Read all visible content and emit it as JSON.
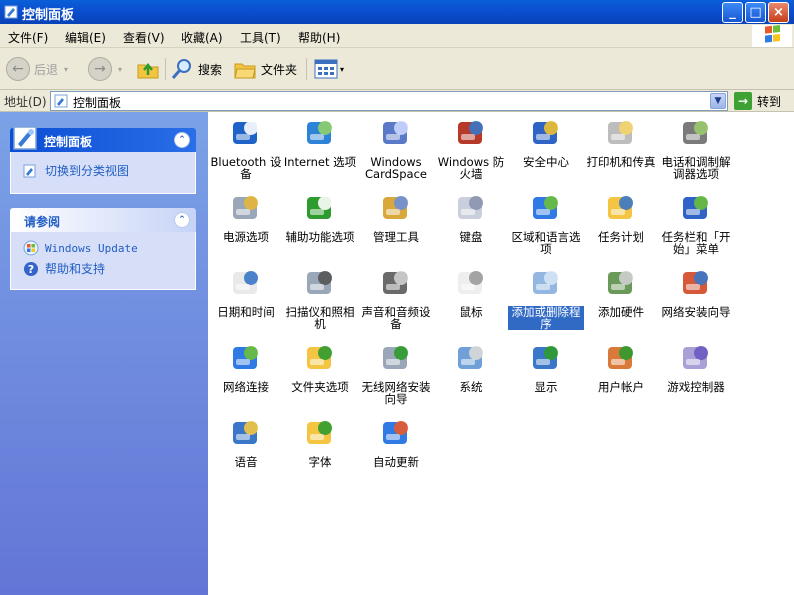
{
  "window": {
    "title": "控制面板",
    "controls": {
      "minimize": "_",
      "maximize": "□",
      "close": "×"
    }
  },
  "menubar": [
    "文件(F)",
    "编辑(E)",
    "查看(V)",
    "收藏(A)",
    "工具(T)",
    "帮助(H)"
  ],
  "toolbar": {
    "back": "后退",
    "search": "搜索",
    "folders": "文件夹"
  },
  "address": {
    "label": "地址(D)",
    "value": "控制面板",
    "go": "转到"
  },
  "sidebar": {
    "control_panel": {
      "title": "控制面板",
      "link": "切换到分类视图"
    },
    "see_also": {
      "title": "请参阅",
      "links": [
        "Windows Update",
        "帮助和支持"
      ]
    }
  },
  "items": [
    {
      "label": "Bluetooth 设备",
      "icon": "bluetooth-icon"
    },
    {
      "label": "Internet 选项",
      "icon": "internet-options-icon"
    },
    {
      "label": "Windows CardSpace",
      "icon": "cardspace-icon"
    },
    {
      "label": "Windows 防火墙",
      "icon": "firewall-icon"
    },
    {
      "label": "安全中心",
      "icon": "security-center-icon"
    },
    {
      "label": "打印机和传真",
      "icon": "printer-icon"
    },
    {
      "label": "电话和调制解调器选项",
      "icon": "phone-modem-icon"
    },
    {
      "label": "电源选项",
      "icon": "power-options-icon"
    },
    {
      "label": "辅助功能选项",
      "icon": "accessibility-icon"
    },
    {
      "label": "管理工具",
      "icon": "admin-tools-icon"
    },
    {
      "label": "键盘",
      "icon": "keyboard-icon"
    },
    {
      "label": "区域和语言选项",
      "icon": "globe-icon"
    },
    {
      "label": "任务计划",
      "icon": "scheduled-tasks-icon"
    },
    {
      "label": "任务栏和「开始」菜单",
      "icon": "taskbar-icon"
    },
    {
      "label": "日期和时间",
      "icon": "date-time-icon"
    },
    {
      "label": "扫描仪和照相机",
      "icon": "scanner-camera-icon"
    },
    {
      "label": "声音和音频设备",
      "icon": "speaker-icon"
    },
    {
      "label": "鼠标",
      "icon": "mouse-icon"
    },
    {
      "label": "添加或删除程序",
      "icon": "add-remove-programs-icon",
      "selected": true
    },
    {
      "label": "添加硬件",
      "icon": "add-hardware-icon"
    },
    {
      "label": "网络安装向导",
      "icon": "network-setup-icon"
    },
    {
      "label": "网络连接",
      "icon": "network-connections-icon"
    },
    {
      "label": "文件夹选项",
      "icon": "folder-options-icon"
    },
    {
      "label": "无线网络安装向导",
      "icon": "wireless-icon"
    },
    {
      "label": "系统",
      "icon": "system-icon"
    },
    {
      "label": "显示",
      "icon": "display-icon"
    },
    {
      "label": "用户帐户",
      "icon": "users-icon"
    },
    {
      "label": "游戏控制器",
      "icon": "gamepad-icon"
    },
    {
      "label": "语音",
      "icon": "speech-icon"
    },
    {
      "label": "字体",
      "icon": "fonts-icon"
    },
    {
      "label": "自动更新",
      "icon": "windows-logo-icon"
    }
  ]
}
